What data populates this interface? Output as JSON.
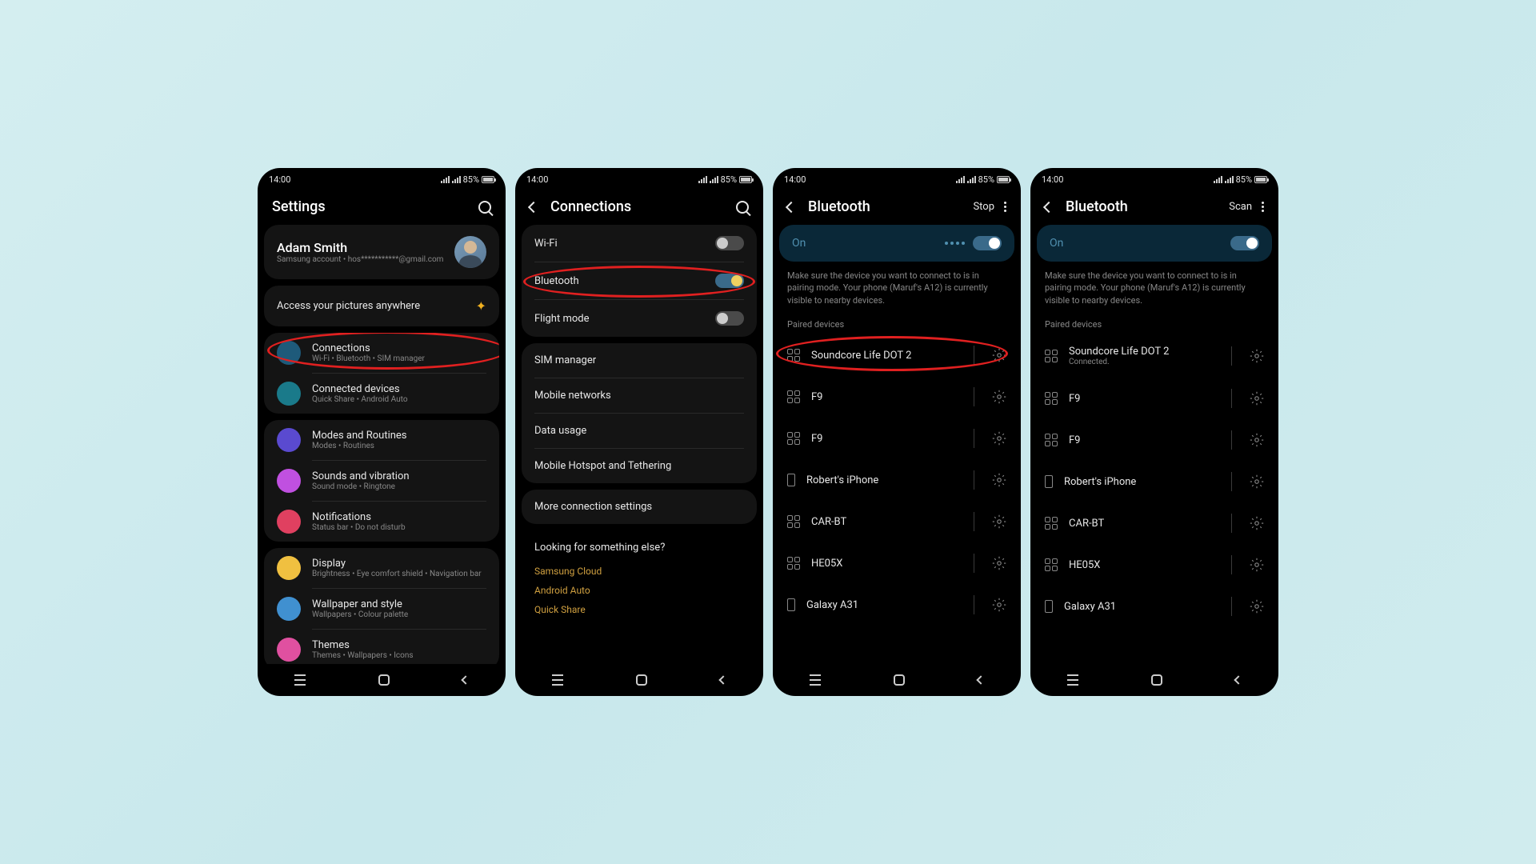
{
  "status": {
    "time": "14:00",
    "battery": "85%"
  },
  "screen1": {
    "title": "Settings",
    "profile": {
      "name": "Adam Smith",
      "subtitle": "Samsung account • hos***********@gmail.com"
    },
    "pictures": "Access your pictures anywhere",
    "groups": [
      {
        "items": [
          {
            "icon": "ic-wifi",
            "title": "Connections",
            "sub": "Wi-Fi • Bluetooth • SIM manager",
            "highlight": true
          },
          {
            "icon": "ic-conn",
            "title": "Connected devices",
            "sub": "Quick Share • Android Auto"
          }
        ]
      },
      {
        "items": [
          {
            "icon": "ic-modes",
            "title": "Modes and Routines",
            "sub": "Modes • Routines"
          },
          {
            "icon": "ic-sound",
            "title": "Sounds and vibration",
            "sub": "Sound mode • Ringtone"
          },
          {
            "icon": "ic-notif",
            "title": "Notifications",
            "sub": "Status bar • Do not disturb"
          }
        ]
      },
      {
        "items": [
          {
            "icon": "ic-display",
            "title": "Display",
            "sub": "Brightness • Eye comfort shield • Navigation bar"
          },
          {
            "icon": "ic-wallpaper",
            "title": "Wallpaper and style",
            "sub": "Wallpapers • Colour palette"
          },
          {
            "icon": "ic-themes",
            "title": "Themes",
            "sub": "Themes • Wallpapers • Icons"
          }
        ]
      }
    ]
  },
  "screen2": {
    "title": "Connections",
    "toggles": [
      {
        "label": "Wi-Fi",
        "on": false
      },
      {
        "label": "Bluetooth",
        "on": true,
        "highlight": true
      },
      {
        "label": "Flight mode",
        "on": false
      }
    ],
    "items": [
      "SIM manager",
      "Mobile networks",
      "Data usage",
      "Mobile Hotspot and Tethering"
    ],
    "more": "More connection settings",
    "looking": {
      "title": "Looking for something else?",
      "links": [
        "Samsung Cloud",
        "Android Auto",
        "Quick Share"
      ]
    }
  },
  "screen3": {
    "title": "Bluetooth",
    "action": "Stop",
    "on_label": "On",
    "show_control_dots": true,
    "help": "Make sure the device you want to connect to is in pairing mode. Your phone (Maruf's A12) is currently visible to nearby devices.",
    "paired_label": "Paired devices",
    "devices": [
      {
        "icon": "grid",
        "name": "Soundcore Life DOT 2",
        "highlight": true
      },
      {
        "icon": "grid",
        "name": "F9"
      },
      {
        "icon": "grid",
        "name": "F9"
      },
      {
        "icon": "phone",
        "name": "Robert's iPhone"
      },
      {
        "icon": "grid",
        "name": "CAR-BT"
      },
      {
        "icon": "grid",
        "name": "HE05X"
      },
      {
        "icon": "phone",
        "name": "Galaxy A31"
      }
    ]
  },
  "screen4": {
    "title": "Bluetooth",
    "action": "Scan",
    "on_label": "On",
    "show_control_dots": false,
    "help": "Make sure the device you want to connect to is in pairing mode. Your phone (Maruf's A12) is currently visible to nearby devices.",
    "paired_label": "Paired devices",
    "devices": [
      {
        "icon": "grid",
        "name": "Soundcore Life DOT 2",
        "sub": "Connected."
      },
      {
        "icon": "grid",
        "name": "F9"
      },
      {
        "icon": "grid",
        "name": "F9"
      },
      {
        "icon": "phone",
        "name": "Robert's iPhone"
      },
      {
        "icon": "grid",
        "name": "CAR-BT"
      },
      {
        "icon": "grid",
        "name": "HE05X"
      },
      {
        "icon": "phone",
        "name": "Galaxy A31"
      }
    ]
  }
}
